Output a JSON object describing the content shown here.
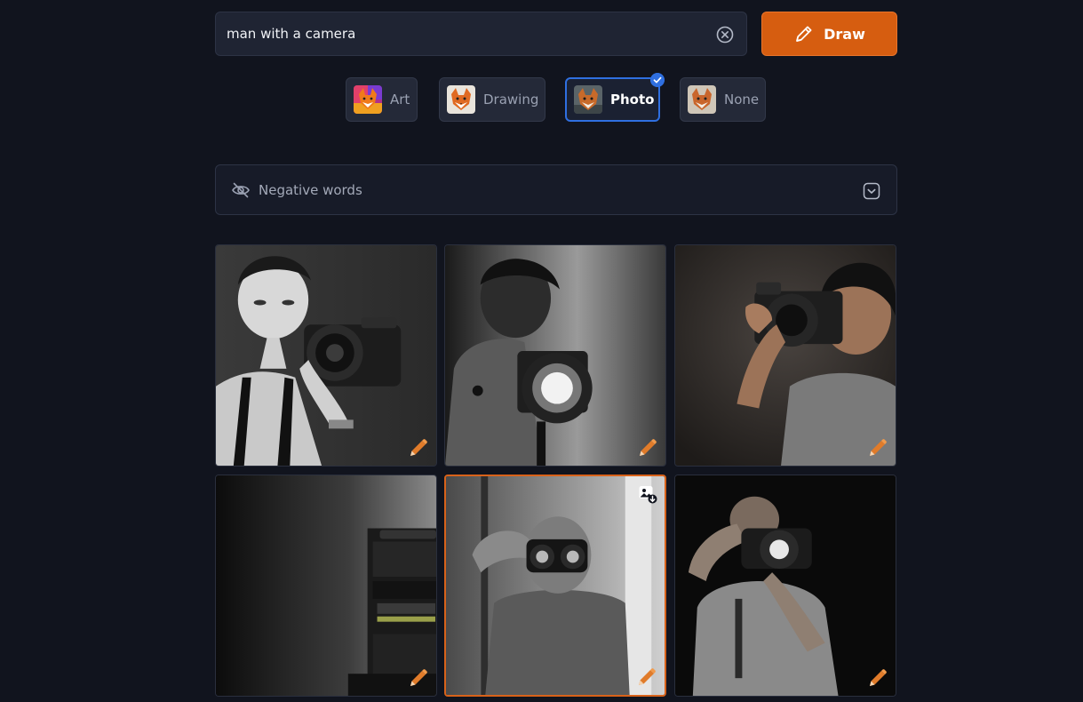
{
  "search": {
    "value": "man with a camera",
    "placeholder": ""
  },
  "draw_button": {
    "label": "Draw"
  },
  "styles": [
    {
      "label": "Art",
      "selected": false
    },
    {
      "label": "Drawing",
      "selected": false
    },
    {
      "label": "Photo",
      "selected": true
    },
    {
      "label": "None",
      "selected": false
    }
  ],
  "negative_words": {
    "label": "Negative words"
  },
  "gallery": {
    "images": [
      {
        "icon": "edit-icon",
        "active": false
      },
      {
        "icon": "edit-icon",
        "active": false
      },
      {
        "icon": "edit-icon",
        "active": false
      },
      {
        "icon": "edit-icon",
        "active": false
      },
      {
        "icon": "edit-icon",
        "active": true
      },
      {
        "icon": "edit-icon",
        "active": false
      }
    ]
  },
  "colors": {
    "background": "#11141e",
    "accent": "#d65d10",
    "selected_border": "#2f6fe0"
  }
}
